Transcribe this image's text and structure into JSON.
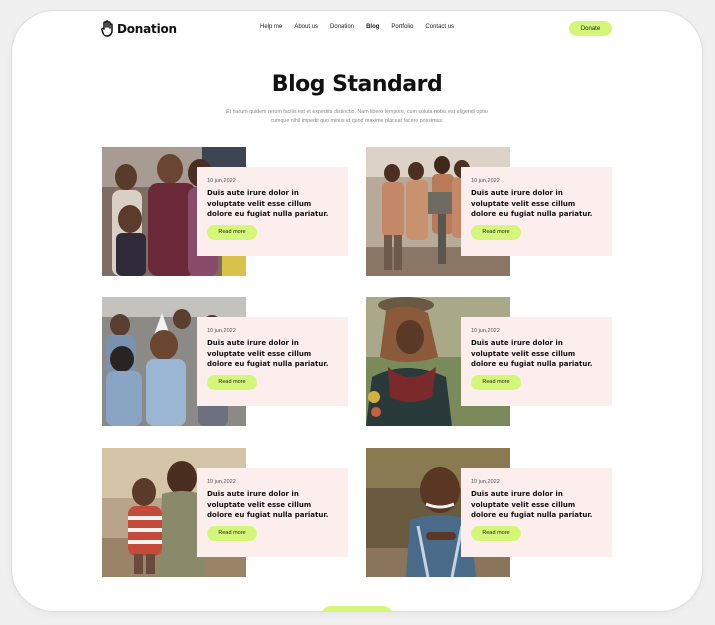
{
  "header": {
    "logo_text": "Donation",
    "nav": [
      "Help me",
      "About us",
      "Donation",
      "Blog",
      "Portfolio",
      "Contact us"
    ],
    "active_nav": "Blog",
    "donate_label": "Donate"
  },
  "hero": {
    "title": "Blog Standard",
    "intro": "Et harum quidem rerum facilis est et expedita distinctio. Nam libero tempore, cum soluta nobis est eligendi optio cumque nihil impedit quo minus id quod maxime placeat facere possimus."
  },
  "posts": [
    {
      "date": "10 jun,2022",
      "headline": "Duis aute irure dolor in voluptate velit esse cillum dolore eu fugiat nulla pariatur.",
      "button": "Read more",
      "image": "smiling-children-group"
    },
    {
      "date": "10 jun,2022",
      "headline": "Duis aute irure dolor in voluptate velit esse cillum dolore eu fugiat nulla pariatur.",
      "button": "Read more",
      "image": "children-at-water-pump"
    },
    {
      "date": "10 jun,2022",
      "headline": "Duis aute irure dolor in voluptate velit esse cillum dolore eu fugiat nulla pariatur.",
      "button": "Read more",
      "image": "boys-in-crowd"
    },
    {
      "date": "10 jun,2022",
      "headline": "Duis aute irure dolor in voluptate velit esse cillum dolore eu fugiat nulla pariatur.",
      "button": "Read more",
      "image": "woman-carrying-basket"
    },
    {
      "date": "10 jun,2022",
      "headline": "Duis aute irure dolor in voluptate velit esse cillum dolore eu fugiat nulla pariatur.",
      "button": "Read more",
      "image": "girl-holding-toddler"
    },
    {
      "date": "10 jun,2022",
      "headline": "Duis aute irure dolor in voluptate velit esse cillum dolore eu fugiat nulla pariatur.",
      "button": "Read more",
      "image": "smiling-boy-outdoors"
    }
  ],
  "colors": {
    "accent": "#d4f77a",
    "panel_bg": "#fdeeee",
    "text_dark": "#111111",
    "text_muted": "#8a8a8a"
  }
}
